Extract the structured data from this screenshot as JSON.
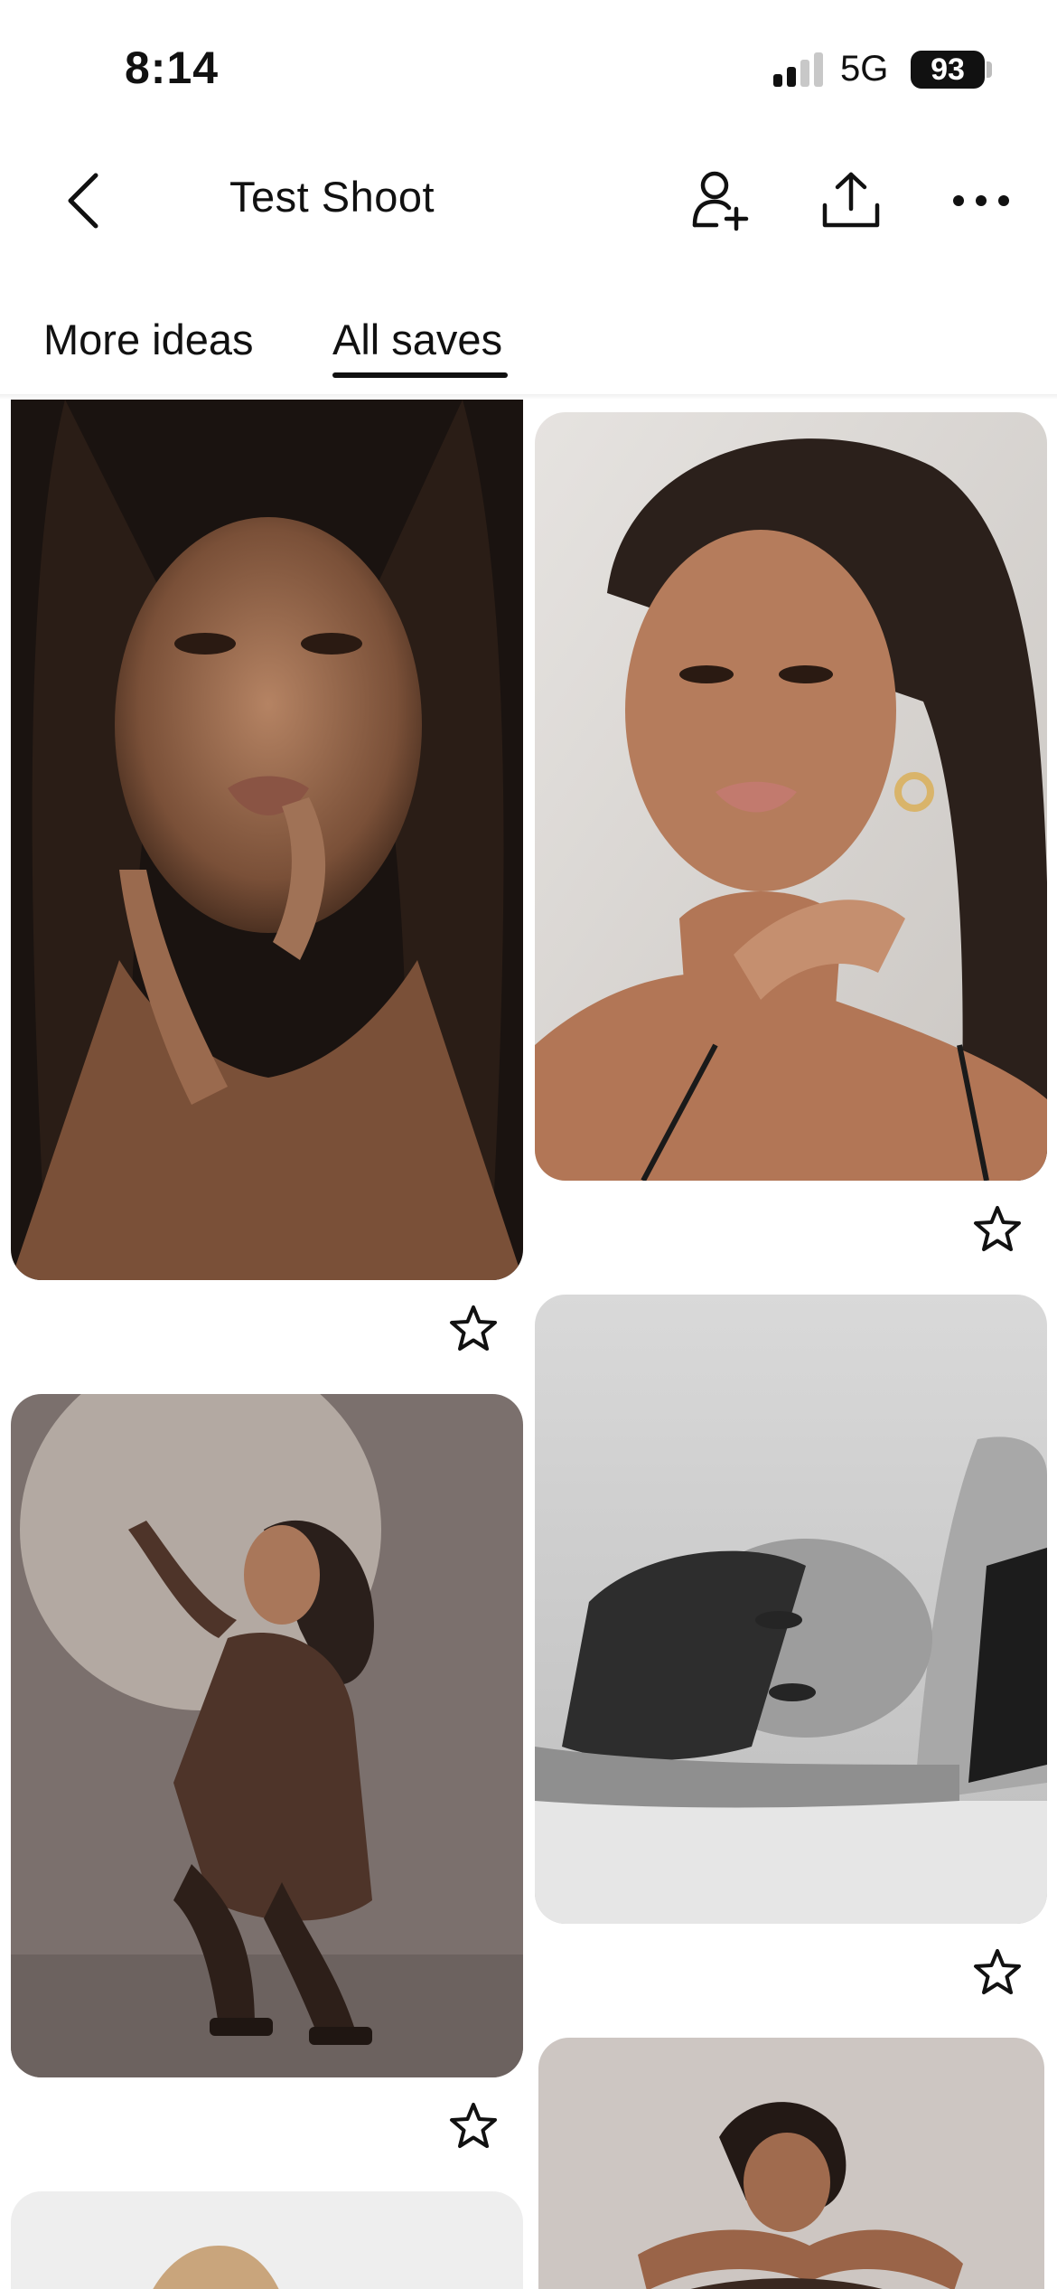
{
  "status_bar": {
    "time": "8:14",
    "network": "5G",
    "battery": "93"
  },
  "header": {
    "title": "Test Shoot"
  },
  "tabs": [
    {
      "label": "More ideas",
      "active": false
    },
    {
      "label": "All saves",
      "active": true
    }
  ],
  "icons": {
    "back": "chevron-left-icon",
    "collaborate": "add-person-icon",
    "share": "share-upload-icon",
    "more": "ellipsis-icon",
    "favorite": "star-outline-icon"
  },
  "pins": [
    {
      "name": "portrait-bronze-makeup",
      "palette": [
        "#1c1411",
        "#8a5f45"
      ]
    },
    {
      "name": "portrait-freckles-gold-earrings",
      "palette": [
        "#dcd9d6",
        "#b07a5a"
      ]
    },
    {
      "name": "crouching-pose-brown-dress",
      "palette": [
        "#7a6f6c",
        "#4a3328"
      ]
    },
    {
      "name": "black-and-white-lying-pose",
      "palette": [
        "#d4d4d4",
        "#3a3a3a"
      ]
    },
    {
      "name": "seated-pose-neutral-backdrop",
      "palette": [
        "#cfc8c4",
        "#5a3d2f"
      ]
    },
    {
      "name": "blonde-portrait-partial",
      "palette": [
        "#efefef",
        "#caa57a"
      ]
    }
  ]
}
